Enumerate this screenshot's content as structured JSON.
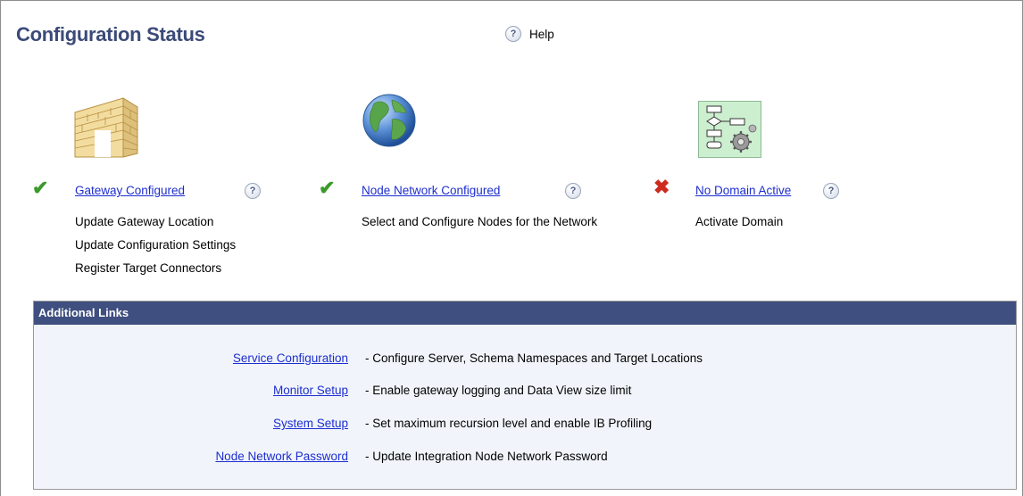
{
  "page": {
    "title": "Configuration Status",
    "help_label": "Help"
  },
  "status_items": [
    {
      "icon": "firewall-gateway-icon",
      "state": "ok",
      "state_symbol": "✔",
      "link_label": "Gateway Configured",
      "descriptions": [
        "Update Gateway Location",
        "Update Configuration Settings",
        "Register Target Connectors"
      ]
    },
    {
      "icon": "globe-network-icon",
      "state": "ok",
      "state_symbol": "✔",
      "link_label": "Node Network Configured",
      "descriptions": [
        "Select and Configure Nodes for the Network"
      ]
    },
    {
      "icon": "flowchart-gear-icon",
      "state": "error",
      "state_symbol": "✖",
      "link_label": "No Domain Active",
      "descriptions": [
        "Activate Domain"
      ]
    }
  ],
  "additional_links": {
    "header": "Additional Links",
    "items": [
      {
        "label": "Service Configuration",
        "description": "- Configure Server, Schema Namespaces and Target Locations"
      },
      {
        "label": "Monitor Setup",
        "description": "- Enable gateway logging and Data View size limit"
      },
      {
        "label": "System Setup",
        "description": "- Set maximum recursion level and enable IB Profiling"
      },
      {
        "label": "Node Network Password",
        "description": "- Update Integration Node Network Password"
      }
    ]
  },
  "colors": {
    "title": "#3b4a78",
    "link": "#1d2ecf",
    "check": "#3a9a2a",
    "cross": "#cc2b20",
    "panel_header": "#3f4f7f",
    "panel_bg": "#f1f5fb"
  }
}
